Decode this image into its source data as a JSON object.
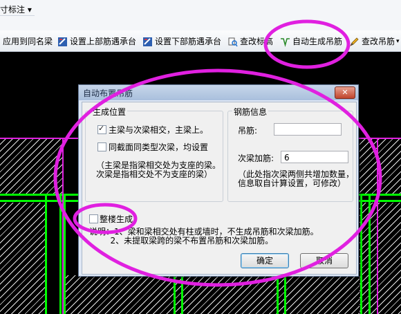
{
  "menu": {
    "title": "寸标注 ▾"
  },
  "toolbar": {
    "items": [
      {
        "label": "应用到同名梁",
        "icon": "none"
      },
      {
        "label": "设置上部筋遇承台",
        "icon": "rebar-edit-icon"
      },
      {
        "label": "设置下部筋遇承台",
        "icon": "rebar-edit-icon"
      },
      {
        "label": "查改标高",
        "icon": "elevation-search-icon"
      },
      {
        "label": "自动生成吊筋",
        "icon": "auto-hanger-icon"
      },
      {
        "label": "查改吊筋",
        "icon": "pencil-icon"
      }
    ],
    "overflow": "▾"
  },
  "dialog": {
    "title": "自动布置吊筋",
    "close": "✕",
    "gen_group": {
      "title": "生成位置",
      "opt_main": "主梁与次梁相交，主梁上。",
      "opt_main_checked": true,
      "opt_same": "同截面同类型次梁，均设置",
      "opt_same_checked": false,
      "note": "（主梁是指梁相交处为支座的梁。\n次梁是指相交处不为支座的梁）"
    },
    "rebar_group": {
      "title": "钢筋信息",
      "hanger_label": "吊筋:",
      "hanger_value": "",
      "secondary_label": "次梁加筋:",
      "secondary_value": "6",
      "note": "（此处指次梁两侧共增加数量，\n信息取自计算设置，可修改）"
    },
    "whole_floor": "整楼生成",
    "whole_floor_checked": false,
    "explain": "说明：1、梁和梁相交处有柱或墙时，不生成吊筋和次梁加筋。\n        2、未提取梁跨的梁不布置吊筋和次梁加筋。",
    "ok": "确定",
    "cancel": "取消"
  },
  "colors": {
    "annotation": "#e020e0",
    "beam": "#00ff00",
    "canvas": "#000000"
  }
}
